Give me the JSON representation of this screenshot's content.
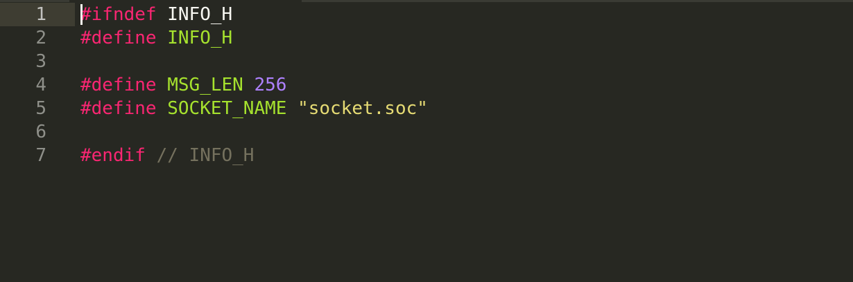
{
  "colors": {
    "background": "#272822",
    "active_line": "#3e3d32",
    "line_number": "#8f908a",
    "directive": "#f92672",
    "identifier_plain": "#f8f8f2",
    "macro_name": "#a6e22e",
    "number": "#ae81ff",
    "string": "#e6db74",
    "comment": "#75715e"
  },
  "editor": {
    "active_line": "1",
    "line_numbers": [
      "1",
      "2",
      "3",
      "4",
      "5",
      "6",
      "7"
    ],
    "lines": [
      {
        "directive": "#ifndef",
        "name": "INFO_H"
      },
      {
        "directive": "#define",
        "name": "INFO_H"
      },
      {},
      {
        "directive": "#define",
        "name": "MSG_LEN",
        "value": "256"
      },
      {
        "directive": "#define",
        "name": "SOCKET_NAME",
        "value": "\"socket.soc\""
      },
      {},
      {
        "directive": "#endif",
        "comment": "// INFO_H"
      }
    ]
  }
}
